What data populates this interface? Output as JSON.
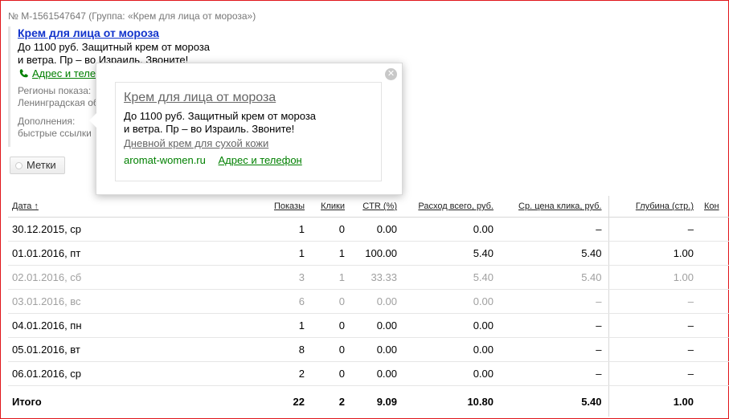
{
  "ad": {
    "id_line": "№ M-1561547647  (Группа: «Крем для лица от мороза»)",
    "title": "Крем для лица от мороза",
    "text_line1": "До 1100 руб. Защитный крем от мороза",
    "text_line2": "и ветра. Пр – во Израиль. Звоните!",
    "contacts_label": "Адрес и телефон",
    "regions_line1": "Регионы показа:",
    "regions_line2": "Ленинградская область",
    "extras_line1": "Дополнения:",
    "extras_line2": "быстрые ссылки"
  },
  "tags_button": "Метки",
  "popup": {
    "close_glyph": "✕",
    "title": "Крем для лица от мороза",
    "text_line1": "До 1100 руб. Защитный крем от мороза",
    "text_line2": "и ветра. Пр – во Израиль. Звоните!",
    "sitelink": "Дневной крем для сухой кожи",
    "domain": "aromat-women.ru",
    "contacts_label": "Адрес и телефон"
  },
  "table": {
    "headers": [
      "Дата ↑",
      "Показы",
      "Клики",
      "CTR (%)",
      "Расход всего, руб.",
      "Ср. цена клика, руб.",
      "Глубина (стр.)",
      "Кон"
    ],
    "rows": [
      {
        "date": "30.12.2015, ср",
        "shows": "1",
        "clicks": "0",
        "ctr": "0.00",
        "spend": "0.00",
        "cpc": "–",
        "depth": "–",
        "muted": false
      },
      {
        "date": "01.01.2016, пт",
        "shows": "1",
        "clicks": "1",
        "ctr": "100.00",
        "spend": "5.40",
        "cpc": "5.40",
        "depth": "1.00",
        "muted": false
      },
      {
        "date": "02.01.2016, сб",
        "shows": "3",
        "clicks": "1",
        "ctr": "33.33",
        "spend": "5.40",
        "cpc": "5.40",
        "depth": "1.00",
        "muted": true
      },
      {
        "date": "03.01.2016, вс",
        "shows": "6",
        "clicks": "0",
        "ctr": "0.00",
        "spend": "0.00",
        "cpc": "–",
        "depth": "–",
        "muted": true
      },
      {
        "date": "04.01.2016, пн",
        "shows": "1",
        "clicks": "0",
        "ctr": "0.00",
        "spend": "0.00",
        "cpc": "–",
        "depth": "–",
        "muted": false
      },
      {
        "date": "05.01.2016, вт",
        "shows": "8",
        "clicks": "0",
        "ctr": "0.00",
        "spend": "0.00",
        "cpc": "–",
        "depth": "–",
        "muted": false
      },
      {
        "date": "06.01.2016, ср",
        "shows": "2",
        "clicks": "0",
        "ctr": "0.00",
        "spend": "0.00",
        "cpc": "–",
        "depth": "–",
        "muted": false
      }
    ],
    "total": {
      "label": "Итого",
      "shows": "22",
      "clicks": "2",
      "ctr": "9.09",
      "spend": "10.80",
      "cpc": "5.40",
      "depth": "1.00"
    }
  },
  "colors": {
    "frame": "#e0161b",
    "link": "#1133cc",
    "green": "#008000"
  }
}
